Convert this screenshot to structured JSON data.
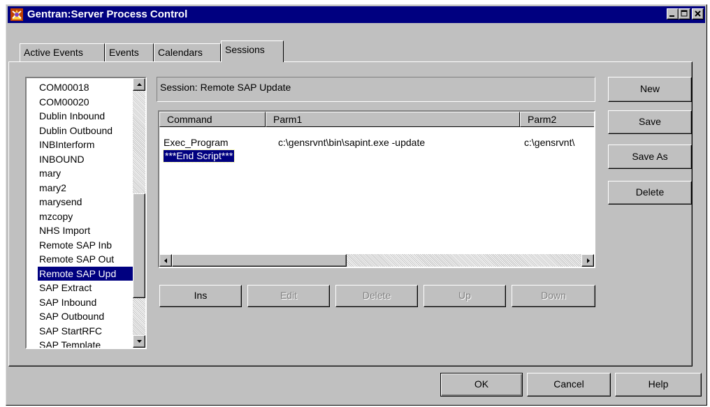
{
  "window": {
    "title": "Gentran:Server Process Control",
    "controls": {
      "minimize": "minimize-icon",
      "maximize": "maximize-icon",
      "close": "close-icon"
    }
  },
  "tabs": [
    {
      "label": "Active Events"
    },
    {
      "label": "Events"
    },
    {
      "label": "Calendars"
    },
    {
      "label": "Sessions",
      "active": true
    }
  ],
  "session_list": {
    "items": [
      "COM00018",
      "COM00020",
      "Dublin Inbound",
      "Dublin Outbound",
      "INBInterform",
      "INBOUND",
      "mary",
      "mary2",
      "marysend",
      "mzcopy",
      "NHS Import",
      "Remote SAP Inb",
      "Remote SAP Out",
      "Remote SAP Upd",
      "SAP Extract",
      "SAP Inbound",
      "SAP Outbound",
      "SAP StartRFC",
      "SAP Template"
    ],
    "selected_index": 13
  },
  "session": {
    "label": "Session:",
    "value": "Remote SAP Update"
  },
  "command_grid": {
    "columns": [
      "Command",
      "Parm1",
      "Parm2"
    ],
    "rows": [
      [
        "Exec_Program",
        "c:\\gensrvnt\\bin\\sapint.exe -update",
        "c:\\gensrvnt\\"
      ],
      [
        "***End Script***",
        "",
        ""
      ]
    ],
    "selected_row": 1
  },
  "grid_buttons": {
    "ins": "Ins",
    "edit": "Edit",
    "delete": "Delete",
    "up": "Up",
    "down": "Down"
  },
  "side_buttons": {
    "new": "New",
    "save": "Save",
    "save_as": "Save As",
    "delete": "Delete"
  },
  "dialog_buttons": {
    "ok": "OK",
    "cancel": "Cancel",
    "help": "Help"
  },
  "colors": {
    "face": "#c0c0c0",
    "title_bar": "#000080",
    "selection": "#000080",
    "shadow": "#808080",
    "highlight": "#ffffff"
  }
}
